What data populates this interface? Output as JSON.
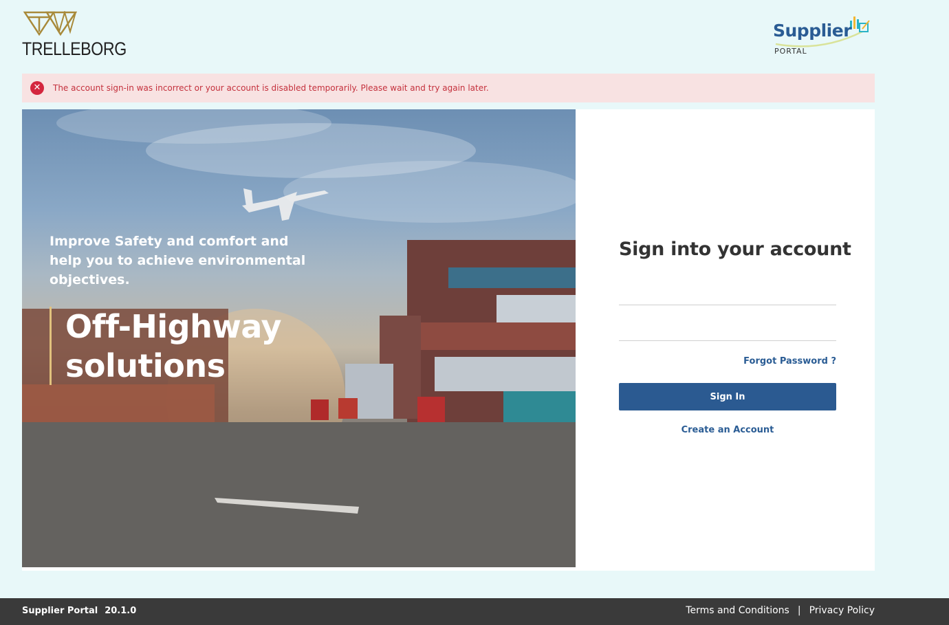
{
  "header": {
    "company_logo_text": "TRELLEBORG",
    "portal_logo": {
      "brand": "Supplier",
      "sub": "PORTAL"
    }
  },
  "alert": {
    "message": "The account sign-in was incorrect or your account is disabled temporarily. Please wait and try again later.",
    "icon": "error-x-icon",
    "color": "#d4263e"
  },
  "hero": {
    "tagline": "Improve Safety and comfort and help you to achieve environmental objectives.",
    "title_line1": "Off-Highway",
    "title_line2": "solutions"
  },
  "login": {
    "title": "Sign into your account",
    "username_value": "",
    "password_value": "",
    "forgot_label": "Forgot Password ?",
    "signin_label": "Sign In",
    "create_label": "Create an Account"
  },
  "footer": {
    "app_name": "Supplier Portal",
    "version": "20.1.0",
    "terms_label": "Terms and Conditions",
    "separator": "|",
    "privacy_label": "Privacy Policy"
  },
  "colors": {
    "page_background": "#e8f8f9",
    "primary": "#2b5a91",
    "footer": "#3a3a3a",
    "alert_background": "#f8e2e2"
  }
}
